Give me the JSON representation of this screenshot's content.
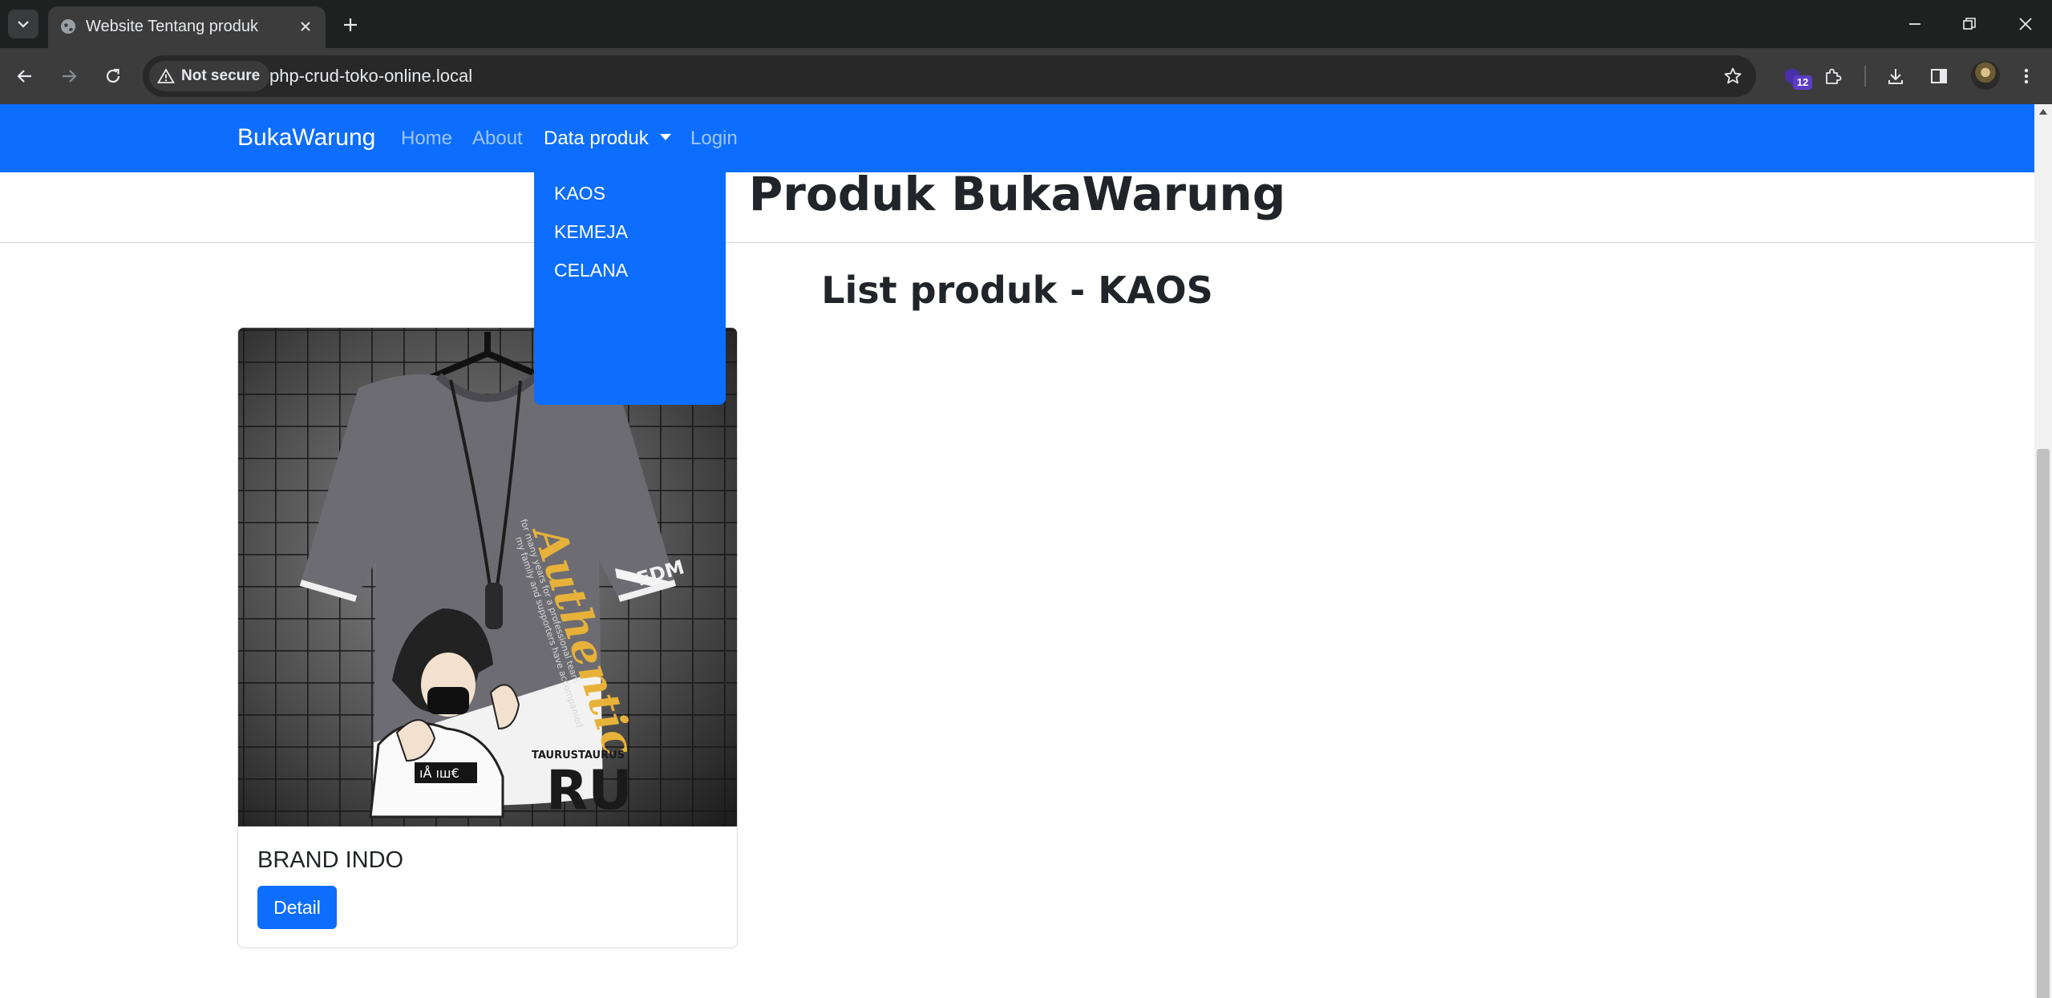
{
  "browser": {
    "tab_title": "Website Tentang produk",
    "security_label": "Not secure",
    "url": "php-crud-toko-online.local",
    "extension_badge": "12"
  },
  "navbar": {
    "brand": "BukaWarung",
    "links": [
      "Home",
      "About",
      "Data produk",
      "Login"
    ],
    "active_link": "Data produk"
  },
  "dropdown": {
    "items": [
      "KAOS",
      "KEMEJA",
      "CELANA"
    ]
  },
  "header": {
    "title": "Produk BukaWarung"
  },
  "section": {
    "title": "List produk - KAOS"
  },
  "products": [
    {
      "name": "BRAND INDO",
      "button": "Detail",
      "image_text": {
        "script": "Authentic",
        "sleeve": "EDM",
        "logo": "RU",
        "brand": "TAURUSTAURUS"
      }
    }
  ],
  "colors": {
    "primary": "#0d6efd",
    "chrome_dark": "#1f2020",
    "chrome_toolbar": "#3c3c3c",
    "text_dark": "#212529"
  },
  "icons": [
    "tab-search-icon",
    "globe-icon",
    "close-icon",
    "plus-icon",
    "minimize-icon",
    "restore-icon",
    "back-icon",
    "forward-icon",
    "reload-icon",
    "warning-icon",
    "star-icon",
    "extensions-icon",
    "download-icon",
    "side-panel-icon",
    "menu-icon",
    "caret-down-icon"
  ]
}
